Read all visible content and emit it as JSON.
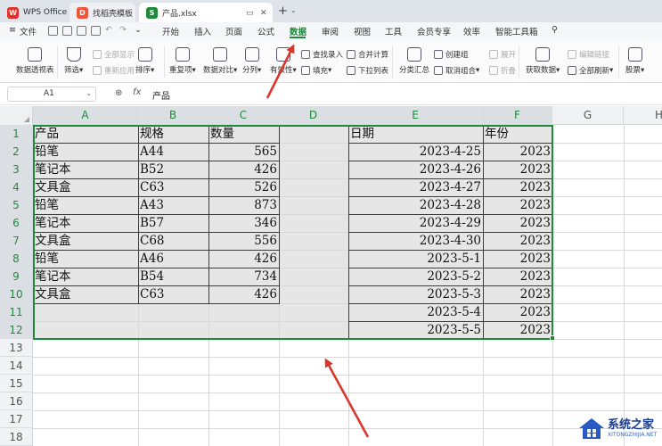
{
  "titlebar": {
    "tabs": [
      {
        "label": "WPS Office",
        "icon": "wps-logo-icon"
      },
      {
        "label": "找稻壳模板",
        "icon": "docer-icon"
      },
      {
        "label": "产品.xlsx",
        "icon": "spreadsheet-s-icon"
      }
    ],
    "new_tab": "+"
  },
  "menubar": {
    "file": "文件",
    "items": [
      "开始",
      "插入",
      "页面",
      "公式",
      "数据",
      "审阅",
      "视图",
      "工具",
      "会员专享",
      "效率",
      "智能工具箱"
    ],
    "active": "数据"
  },
  "ribbon": {
    "pivot": "数据透视表",
    "filter": "筛选",
    "show_all": "全部显示",
    "reapply": "重新应用",
    "sort": "排序",
    "duplicates": "重复项",
    "compare": "数据对比",
    "split": "分列",
    "validity": "有效性",
    "lookup": "查找录入",
    "fill": "填充",
    "consolidate": "合并计算",
    "dropdown": "下拉列表",
    "subtotal": "分类汇总",
    "group": "创建组",
    "ungroup": "取消组合",
    "expand": "展开",
    "collapse": "折叠",
    "get_data": "获取数据",
    "edit_links": "编辑链接",
    "refresh_all": "全部刷新",
    "stocks": "股票"
  },
  "formula_bar": {
    "cell_ref": "A1",
    "content": "产品"
  },
  "grid": {
    "columns": [
      "A",
      "B",
      "C",
      "D",
      "E",
      "F",
      "G",
      "H"
    ],
    "rows": [
      "1",
      "2",
      "3",
      "4",
      "5",
      "6",
      "7",
      "8",
      "9",
      "10",
      "11",
      "12",
      "13",
      "14",
      "15",
      "16",
      "17",
      "18"
    ],
    "table1": {
      "headers": [
        "产品",
        "规格",
        "数量"
      ],
      "rows": [
        [
          "铅笔",
          "A44",
          "565"
        ],
        [
          "笔记本",
          "B52",
          "426"
        ],
        [
          "文具盒",
          "C63",
          "526"
        ],
        [
          "铅笔",
          "A43",
          "873"
        ],
        [
          "笔记本",
          "B57",
          "346"
        ],
        [
          "文具盒",
          "C68",
          "556"
        ],
        [
          "铅笔",
          "A46",
          "426"
        ],
        [
          "笔记本",
          "B54",
          "734"
        ],
        [
          "文具盒",
          "C63",
          "426"
        ]
      ]
    },
    "table2": {
      "headers": [
        "日期",
        "年份"
      ],
      "rows": [
        [
          "2023-4-25",
          "2023"
        ],
        [
          "2023-4-26",
          "2023"
        ],
        [
          "2023-4-27",
          "2023"
        ],
        [
          "2023-4-28",
          "2023"
        ],
        [
          "2023-4-29",
          "2023"
        ],
        [
          "2023-4-30",
          "2023"
        ],
        [
          "2023-5-1",
          "2023"
        ],
        [
          "2023-5-2",
          "2023"
        ],
        [
          "2023-5-3",
          "2023"
        ],
        [
          "2023-5-4",
          "2023"
        ],
        [
          "2023-5-5",
          "2023"
        ]
      ]
    }
  },
  "watermark": {
    "title": "系统之家",
    "url": "XITONGZHIJIA.NET"
  },
  "colors": {
    "accent": "#1f8a3b",
    "arrow": "#d9372b",
    "selection_fill": "#e6e6e6"
  }
}
